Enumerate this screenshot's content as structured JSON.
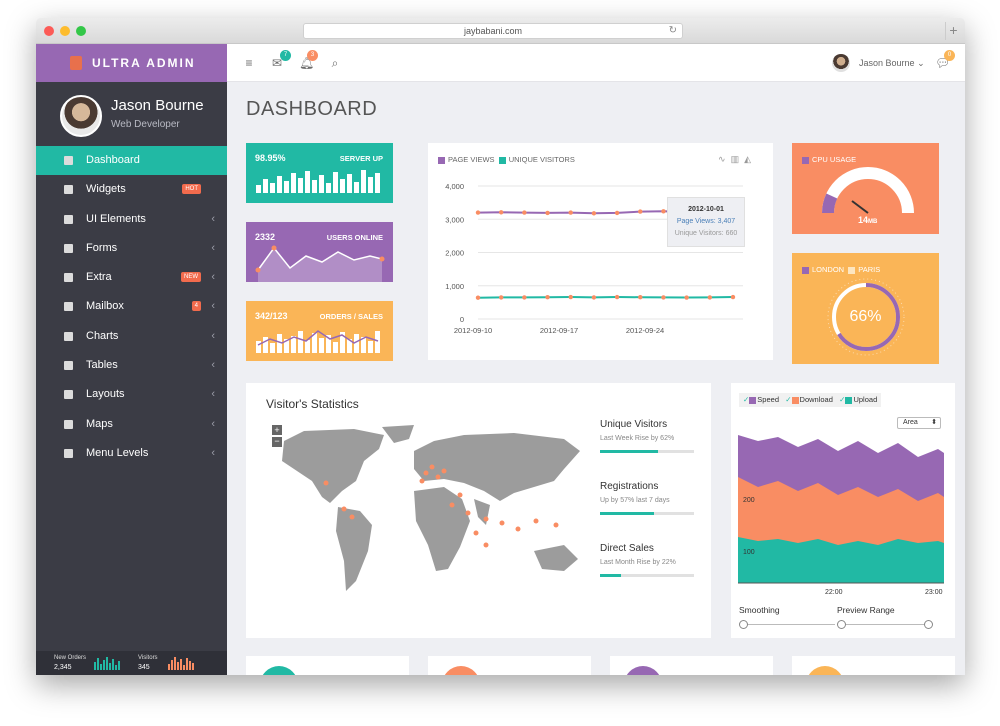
{
  "browser": {
    "url": "jaybabani.com"
  },
  "brand": {
    "name": "ULTRA ADMIN"
  },
  "profile": {
    "name": "Jason Bourne",
    "role": "Web Developer"
  },
  "nav": [
    {
      "label": "Dashboard",
      "icon": "dashboard-icon",
      "active": true
    },
    {
      "label": "Widgets",
      "icon": "widgets-icon",
      "badge": "HOT"
    },
    {
      "label": "UI Elements",
      "icon": "briefcase-icon",
      "chevron": true
    },
    {
      "label": "Forms",
      "icon": "sliders-icon",
      "chevron": true
    },
    {
      "label": "Extra",
      "icon": "gift-icon",
      "badge": "NEW",
      "chevron": true
    },
    {
      "label": "Mailbox",
      "icon": "envelope-icon",
      "badge": "4",
      "chevron": true
    },
    {
      "label": "Charts",
      "icon": "bar-chart-icon",
      "chevron": true
    },
    {
      "label": "Tables",
      "icon": "table-icon",
      "chevron": true
    },
    {
      "label": "Layouts",
      "icon": "columns-icon",
      "chevron": true
    },
    {
      "label": "Maps",
      "icon": "map-marker-icon",
      "chevron": true
    },
    {
      "label": "Menu Levels",
      "icon": "folder-icon",
      "chevron": true
    }
  ],
  "sidebar_footer": {
    "orders_label": "New Orders",
    "orders_value": "2,345",
    "visitors_label": "Visitors",
    "visitors_value": "345"
  },
  "topbar": {
    "mail_count": "7",
    "notif_count": "3",
    "user_name": "Jason Bourne",
    "chat_count": "0"
  },
  "page": {
    "title": "DASHBOARD"
  },
  "stats": [
    {
      "value": "98.95%",
      "label": "SERVER UP",
      "color": "#21b9a4"
    },
    {
      "value": "2332",
      "label": "USERS ONLINE",
      "color": "#9768b3"
    },
    {
      "value": "342/123",
      "label": "ORDERS / SALES",
      "color": "#fab557"
    }
  ],
  "traffic_chart": {
    "legend": [
      "PAGE VIEWS",
      "UNIQUE VISITORS"
    ],
    "yticks": [
      "4,000",
      "3,000",
      "2,000",
      "1,000",
      "0"
    ],
    "xticks": [
      "2012-09-10",
      "2012-09-17",
      "2012-09-24"
    ],
    "tooltip": {
      "date": "2012-10-01",
      "views": "Page Views: 3,407",
      "visitors": "Unique Visitors: 660"
    }
  },
  "chart_data": [
    {
      "type": "line",
      "title": "",
      "series": [
        {
          "name": "PAGE VIEWS",
          "values": [
            3200,
            3210,
            3200,
            3190,
            3200,
            3180,
            3190,
            3230,
            3240,
            3220,
            3400,
            3407
          ]
        },
        {
          "name": "UNIQUE VISITORS",
          "values": [
            640,
            650,
            650,
            655,
            660,
            650,
            660,
            655,
            650,
            645,
            650,
            660
          ]
        }
      ],
      "ylim": [
        0,
        4000
      ]
    }
  ],
  "cpu": {
    "label": "CPU USAGE",
    "value": "14",
    "unit": "MB",
    "fraction": 0.14
  },
  "storage": {
    "legend": [
      "LONDON",
      "PARIS"
    ],
    "percent": "66%",
    "fraction": 0.66
  },
  "visitor_stats": {
    "title": "Visitor's Statistics",
    "items": [
      {
        "title": "Unique Visitors",
        "sub": "Last Week Rise by 62%",
        "fraction": 0.62
      },
      {
        "title": "Registrations",
        "sub": "Up by 57% last 7 days",
        "fraction": 0.57
      },
      {
        "title": "Direct Sales",
        "sub": "Last Month Rise by 22%",
        "fraction": 0.22
      }
    ]
  },
  "network": {
    "legend": [
      "Speed",
      "Download",
      "Upload"
    ],
    "select": "Area",
    "ylabels": [
      "200",
      "100"
    ],
    "xlabels": [
      "22:00",
      "23:00"
    ],
    "smoothing": "Smoothing",
    "preview": "Preview Range"
  },
  "colors": {
    "teal": "#21b9a4",
    "purple": "#9768b3",
    "orange": "#f98d63",
    "yellow": "#fab557",
    "dark": "#3b3c45"
  }
}
